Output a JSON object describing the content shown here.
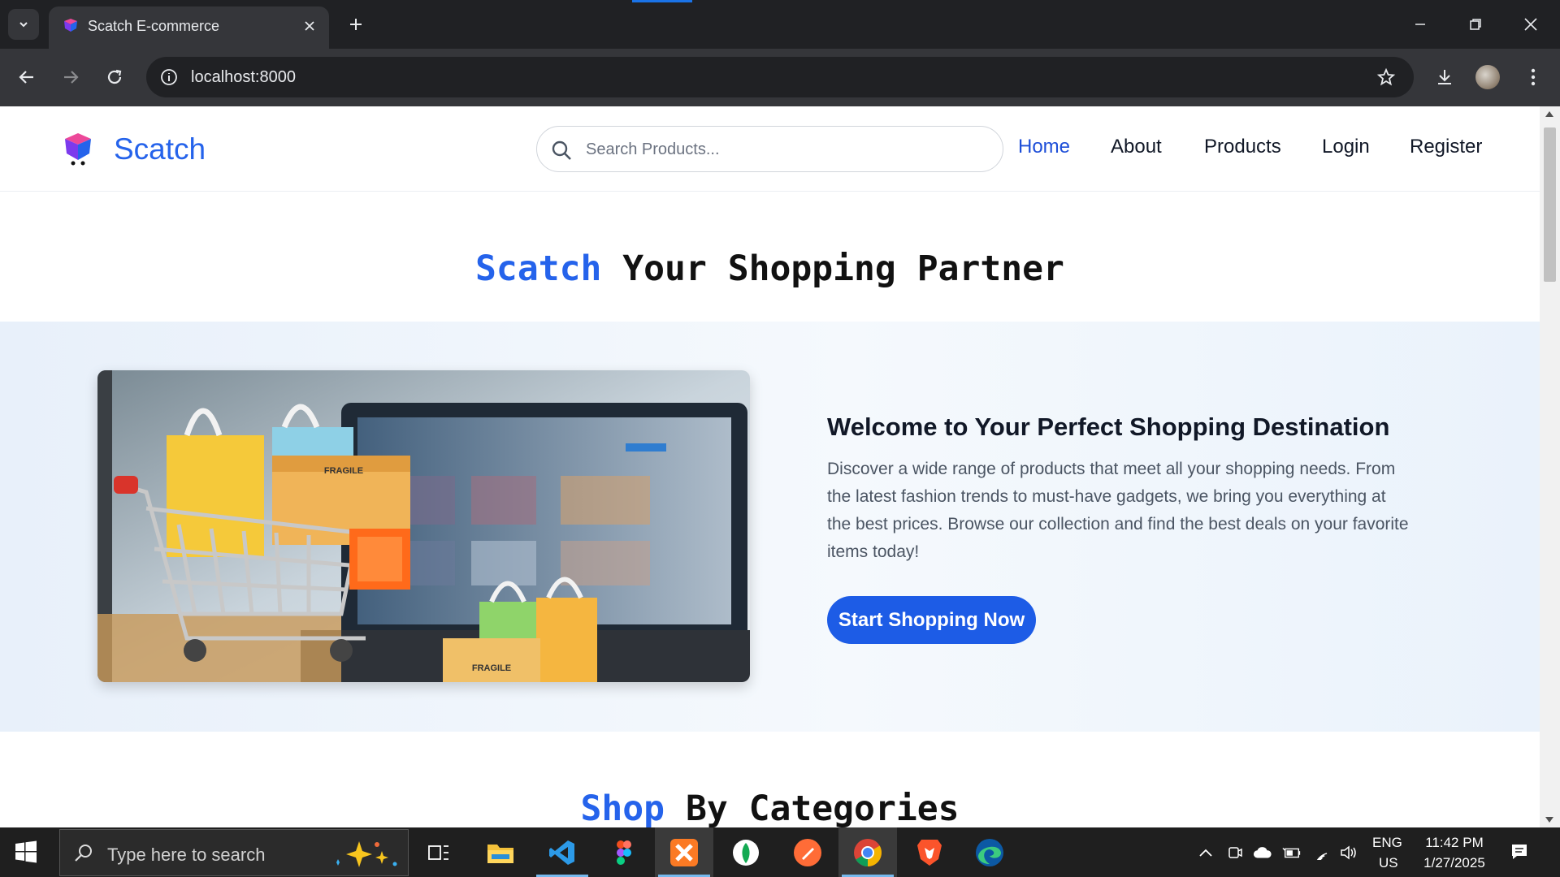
{
  "browser": {
    "tab_title": "Scatch E-commerce",
    "url": "localhost:8000"
  },
  "site": {
    "logo_text": "Scatch",
    "search": {
      "placeholder": "Search Products...",
      "value": ""
    },
    "nav": [
      {
        "label": "Home",
        "active": true
      },
      {
        "label": "About"
      },
      {
        "label": "Products"
      },
      {
        "label": "Login"
      },
      {
        "label": "Register"
      }
    ],
    "hero_title": {
      "accent": "Scatch",
      "rest": " Your Shopping Partner"
    },
    "hero": {
      "heading": "Welcome to Your Perfect Shopping Destination",
      "description": "Discover a wide range of products that meet all your shopping needs. From the latest fashion trends to must-have gadgets, we bring you everything at the best prices. Browse our collection and find the best deals on your favorite items today!",
      "cta_label": "Start Shopping Now",
      "image_label_1": "FRAGILE",
      "image_label_2": "FRAGILE"
    },
    "categories_title": {
      "accent": "Shop",
      "rest": " By Categories"
    },
    "accent_color": "#2563eb"
  },
  "taskbar": {
    "search_placeholder": "Type here to search",
    "apps": [
      "task-view",
      "file-explorer",
      "vs-code",
      "figma",
      "xampp",
      "mongodb-compass",
      "postman",
      "chrome",
      "brave",
      "edge"
    ],
    "language": "ENG",
    "region": "US",
    "time": "11:42 PM",
    "date": "1/27/2025"
  }
}
